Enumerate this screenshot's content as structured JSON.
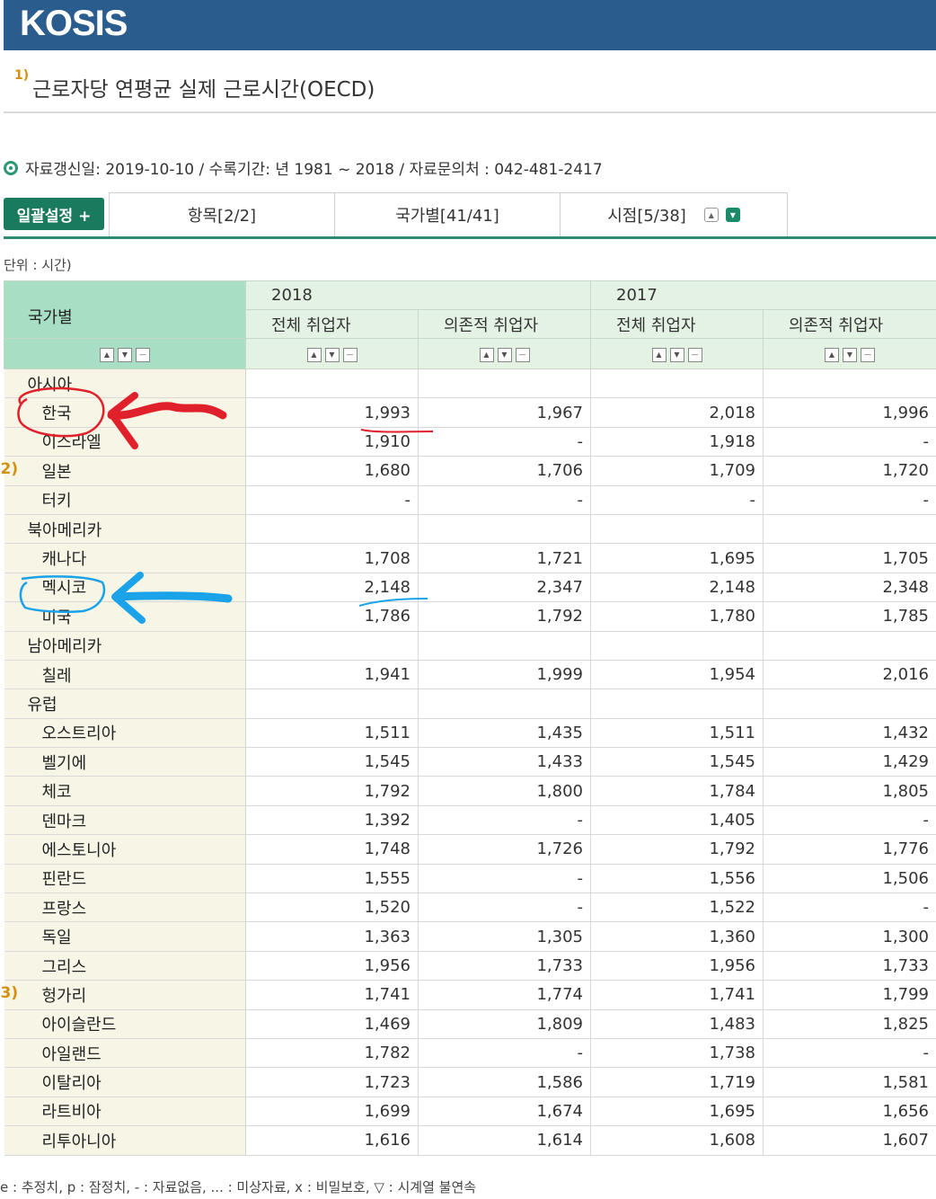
{
  "header": {
    "logo": "KOSIS"
  },
  "title": {
    "sup": "1)",
    "text": "근로자당 연평균 실제 근로시간(OECD)"
  },
  "info": {
    "text": "자료갱신일: 2019-10-10 / 수록기간: 년 1981 ~ 2018 / 자료문의처 : 042-481-2417"
  },
  "toolbar": {
    "bulk_label": "일괄설정 +",
    "tabs": [
      "항목[2/2]",
      "국가별[41/41]",
      "시점[5/38]"
    ]
  },
  "unit": "단위 : 시간)",
  "table": {
    "corner": "국가별",
    "years": [
      "2018",
      "2017"
    ],
    "sub_headers": [
      "전체 취업자",
      "의존적 취업자",
      "전체 취업자",
      "의존적 취업자"
    ],
    "rows": [
      {
        "name": "아시아",
        "type": "region",
        "note": "",
        "values": [
          "",
          "",
          "",
          ""
        ]
      },
      {
        "name": "한국",
        "type": "country",
        "note": "",
        "values": [
          "1,993",
          "1,967",
          "2,018",
          "1,996"
        ]
      },
      {
        "name": "이스라엘",
        "type": "country",
        "note": "",
        "values": [
          "1,910",
          "-",
          "1,918",
          "-"
        ]
      },
      {
        "name": "일본",
        "type": "country",
        "note": "2)",
        "values": [
          "1,680",
          "1,706",
          "1,709",
          "1,720"
        ]
      },
      {
        "name": "터키",
        "type": "country",
        "note": "",
        "values": [
          "-",
          "-",
          "-",
          "-"
        ]
      },
      {
        "name": "북아메리카",
        "type": "region",
        "note": "",
        "values": [
          "",
          "",
          "",
          ""
        ]
      },
      {
        "name": "캐나다",
        "type": "country",
        "note": "",
        "values": [
          "1,708",
          "1,721",
          "1,695",
          "1,705"
        ]
      },
      {
        "name": "멕시코",
        "type": "country",
        "note": "",
        "values": [
          "2,148",
          "2,347",
          "2,148",
          "2,348"
        ]
      },
      {
        "name": "미국",
        "type": "country",
        "note": "",
        "values": [
          "1,786",
          "1,792",
          "1,780",
          "1,785"
        ]
      },
      {
        "name": "남아메리카",
        "type": "region",
        "note": "",
        "values": [
          "",
          "",
          "",
          ""
        ]
      },
      {
        "name": "칠레",
        "type": "country",
        "note": "",
        "values": [
          "1,941",
          "1,999",
          "1,954",
          "2,016"
        ]
      },
      {
        "name": "유럽",
        "type": "region",
        "note": "",
        "values": [
          "",
          "",
          "",
          ""
        ]
      },
      {
        "name": "오스트리아",
        "type": "country",
        "note": "",
        "values": [
          "1,511",
          "1,435",
          "1,511",
          "1,432"
        ]
      },
      {
        "name": "벨기에",
        "type": "country",
        "note": "",
        "values": [
          "1,545",
          "1,433",
          "1,545",
          "1,429"
        ]
      },
      {
        "name": "체코",
        "type": "country",
        "note": "",
        "values": [
          "1,792",
          "1,800",
          "1,784",
          "1,805"
        ]
      },
      {
        "name": "덴마크",
        "type": "country",
        "note": "",
        "values": [
          "1,392",
          "-",
          "1,405",
          "-"
        ]
      },
      {
        "name": "에스토니아",
        "type": "country",
        "note": "",
        "values": [
          "1,748",
          "1,726",
          "1,792",
          "1,776"
        ]
      },
      {
        "name": "핀란드",
        "type": "country",
        "note": "",
        "values": [
          "1,555",
          "-",
          "1,556",
          "1,506"
        ]
      },
      {
        "name": "프랑스",
        "type": "country",
        "note": "",
        "values": [
          "1,520",
          "-",
          "1,522",
          "-"
        ]
      },
      {
        "name": "독일",
        "type": "country",
        "note": "",
        "values": [
          "1,363",
          "1,305",
          "1,360",
          "1,300"
        ]
      },
      {
        "name": "그리스",
        "type": "country",
        "note": "",
        "values": [
          "1,956",
          "1,733",
          "1,956",
          "1,733"
        ]
      },
      {
        "name": "헝가리",
        "type": "country",
        "note": "3)",
        "values": [
          "1,741",
          "1,774",
          "1,741",
          "1,799"
        ]
      },
      {
        "name": "아이슬란드",
        "type": "country",
        "note": "",
        "values": [
          "1,469",
          "1,809",
          "1,483",
          "1,825"
        ]
      },
      {
        "name": "아일랜드",
        "type": "country",
        "note": "",
        "values": [
          "1,782",
          "-",
          "1,738",
          "-"
        ]
      },
      {
        "name": "이탈리아",
        "type": "country",
        "note": "",
        "values": [
          "1,723",
          "1,586",
          "1,719",
          "1,581"
        ]
      },
      {
        "name": "라트비아",
        "type": "country",
        "note": "",
        "values": [
          "1,699",
          "1,674",
          "1,695",
          "1,656"
        ]
      },
      {
        "name": "리투아니아",
        "type": "country",
        "note": "",
        "values": [
          "1,616",
          "1,614",
          "1,608",
          "1,607"
        ]
      }
    ]
  },
  "legend": "e : 추정치, p : 잠정치, - : 자료없음, ... : 미상자료, x : 비밀보호, ▽ : 시계열 불연속",
  "annotations": {
    "red": "#e0202a",
    "blue": "#1aa3e8"
  }
}
